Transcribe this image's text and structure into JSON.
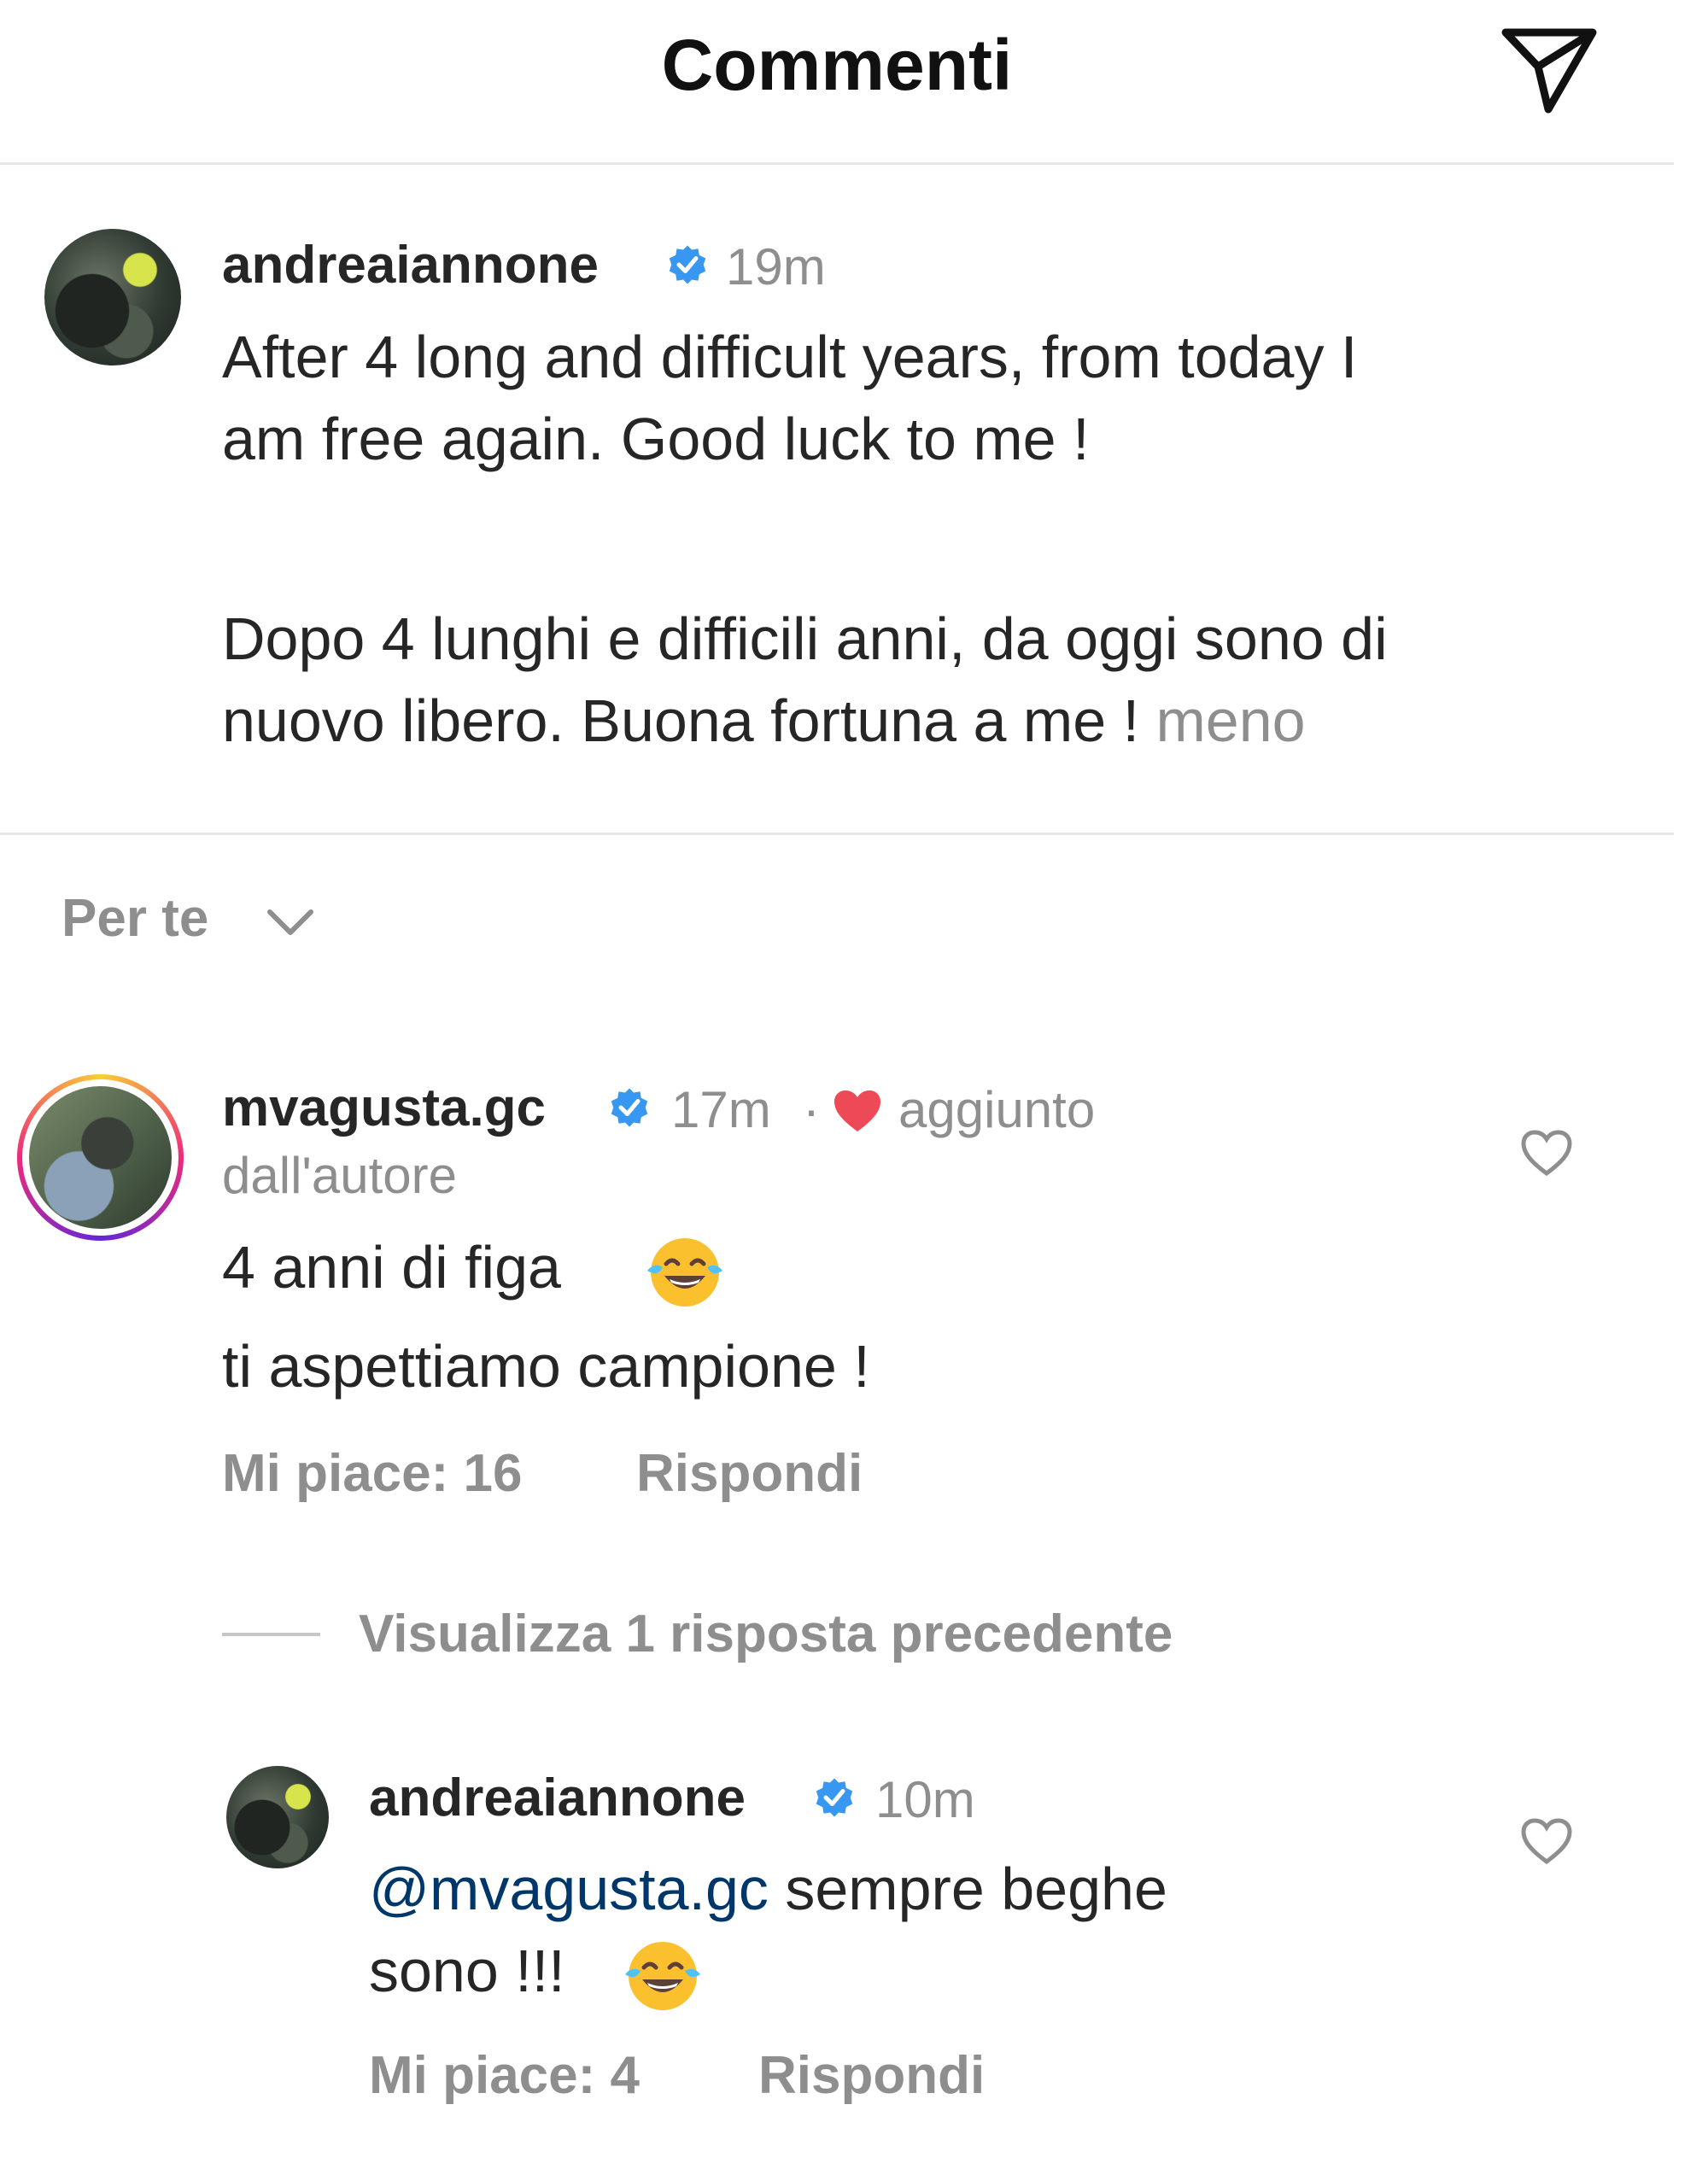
{
  "header": {
    "title": "Commenti",
    "share_icon": "send-icon"
  },
  "post": {
    "username": "andreaiannone",
    "verified": true,
    "time": "19m",
    "lines": [
      "After 4 long and difficult years, from today I",
      "am free again. Good luck to me !",
      "Dopo 4 lunghi e difficili anni, da oggi sono di",
      "nuovo libero. Buona fortuna a me !"
    ],
    "less_label": "meno"
  },
  "sort": {
    "label": "Per te",
    "icon": "chevron-down-icon"
  },
  "comment": {
    "username": "mvagusta.gc",
    "verified": true,
    "time": "17m",
    "separator": "·",
    "liked_by_author_line1": "aggiunto",
    "liked_by_author_line2": "dall'autore",
    "line1": "4 anni di figa",
    "line2": "ti aspettiamo campione !",
    "emoji": "face-with-tears-of-joy",
    "likes_label": "Mi piace: 16",
    "reply_label": "Rispondi"
  },
  "view_replies_label": "Visualizza 1 risposta precedente",
  "reply": {
    "username": "andreaiannone",
    "verified": true,
    "time": "10m",
    "mention": "@mvagusta.gc",
    "line1_rest": " sempre beghe",
    "line2": "sono !!!",
    "emoji": "face-with-tears-of-joy",
    "likes_label": "Mi piace: 4",
    "reply_label": "Rispondi"
  },
  "colors": {
    "text": "#262626",
    "muted": "#8e8e8e",
    "verified_blue": "#3897f0",
    "heart_red": "#ed4956",
    "mention": "#00376b"
  }
}
